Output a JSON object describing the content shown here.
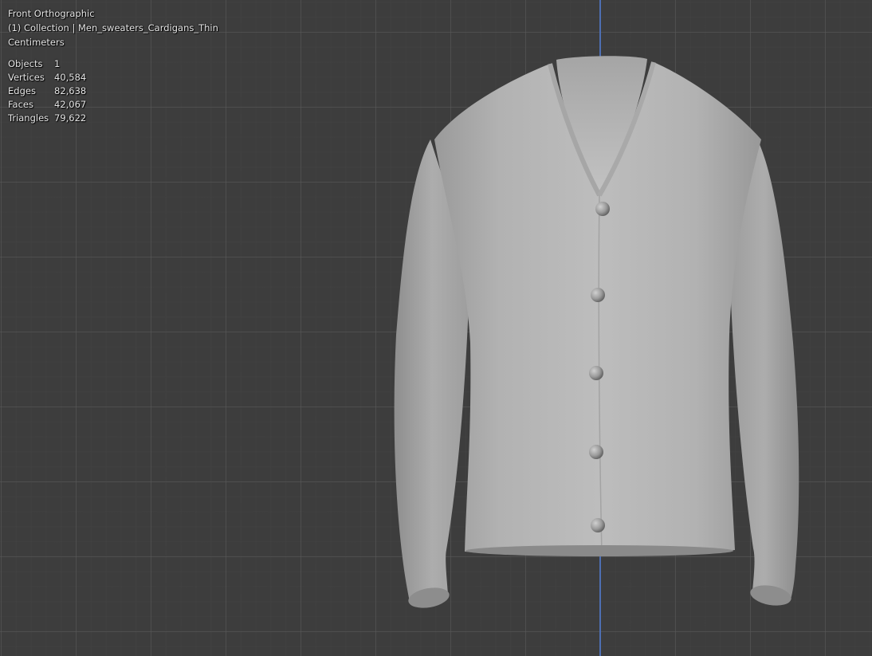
{
  "viewport": {
    "view_name": "Front Orthographic",
    "collection_line": "(1) Collection | Men_sweaters_Cardigans_Thin",
    "units": "Centimeters"
  },
  "stats": [
    {
      "label": "Objects",
      "value": "1"
    },
    {
      "label": "Vertices",
      "value": "40,584"
    },
    {
      "label": "Edges",
      "value": "82,638"
    },
    {
      "label": "Faces",
      "value": "42,067"
    },
    {
      "label": "Triangles",
      "value": "79,622"
    }
  ],
  "colors": {
    "background": "#3d3d3d",
    "grid_major": "#5a5a5a",
    "axis_z": "#4e6fb3",
    "mesh": "#b4b4b4"
  }
}
